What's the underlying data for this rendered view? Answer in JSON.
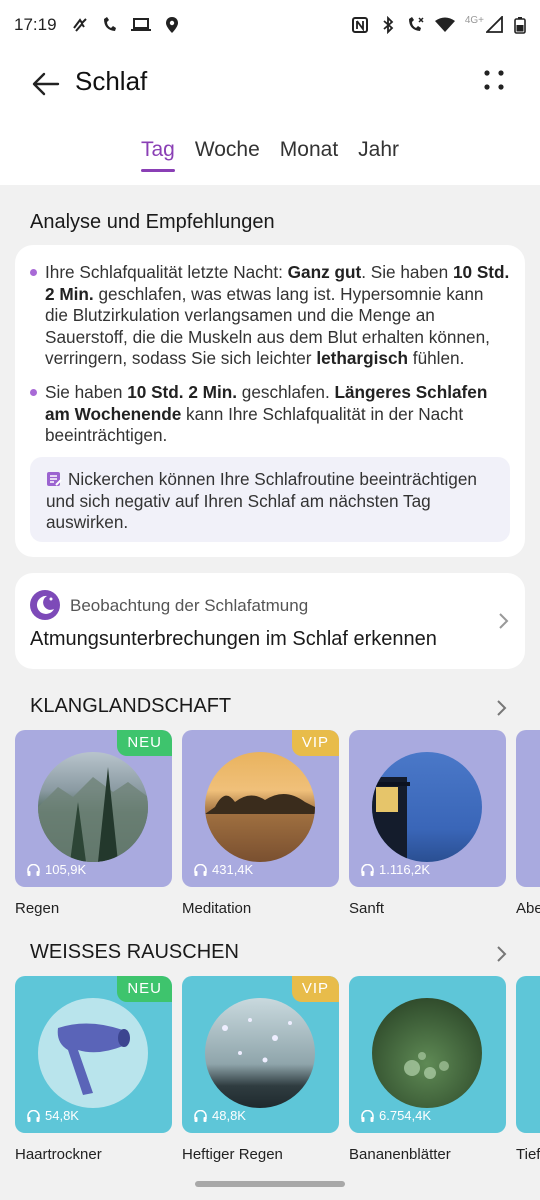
{
  "status": {
    "time": "17:19",
    "net": "4G+"
  },
  "header": {
    "title": "Schlaf"
  },
  "tabs": [
    {
      "label": "Tag",
      "active": true
    },
    {
      "label": "Woche"
    },
    {
      "label": "Monat"
    },
    {
      "label": "Jahr"
    }
  ],
  "analysis": {
    "heading": "Analyse und Empfehlungen",
    "p1": {
      "t1": "Ihre Schlafqualität letzte Nacht: ",
      "b1": "Ganz gut",
      "t2": ". Sie haben ",
      "b2": "10 Std. 2 Min.",
      "t3": " geschlafen, was etwas lang ist. Hypersomnie kann die Blutzirkulation verlangsamen und die Menge an Sauerstoff, die die Muskeln aus dem Blut erhalten können, verringern, sodass Sie sich leichter ",
      "b3": "lethargisch",
      "t4": " fühlen."
    },
    "p2": {
      "t1": "Sie haben ",
      "b1": "10 Std. 2 Min.",
      "t2": " geschlafen. ",
      "b2": "Längeres Schlafen am Wochenende",
      "t3": " kann Ihre Schlafqualität in der Nacht beeinträchtigen."
    },
    "tip": "Nickerchen können Ihre Schlafroutine beeinträchtigen und sich negativ auf Ihren Schlaf am nächsten Tag auswirken."
  },
  "breathing": {
    "label": "Beobachtung der Schlafatmung",
    "title": "Atmungsunterbrechungen im Schlaf erkennen"
  },
  "soundscape": {
    "heading": "KLANGLANDSCHAFT",
    "items": [
      {
        "name": "Regen",
        "plays": "105,9K",
        "badge": "NEU"
      },
      {
        "name": "Meditation",
        "plays": "431,4K",
        "badge": "VIP"
      },
      {
        "name": "Sanft",
        "plays": "1.116,2K",
        "badge": ""
      },
      {
        "name": "Abe",
        "plays": "",
        "badge": ""
      }
    ]
  },
  "whitenoise": {
    "heading": "WEISSES RAUSCHEN",
    "items": [
      {
        "name": "Haartrockner",
        "plays": "54,8K",
        "badge": "NEU"
      },
      {
        "name": "Heftiger Regen",
        "plays": "48,8K",
        "badge": "VIP"
      },
      {
        "name": "Bananenblätter",
        "plays": "6.754,4K",
        "badge": ""
      },
      {
        "name": "Tief",
        "plays": "",
        "badge": ""
      }
    ]
  },
  "colors": {
    "accent": "#8a3fb5",
    "neu": "#3ec46d",
    "vip": "#e8bc4a",
    "soundscape_tile": "#a9aadf",
    "noise_tile": "#5ec6d8"
  }
}
